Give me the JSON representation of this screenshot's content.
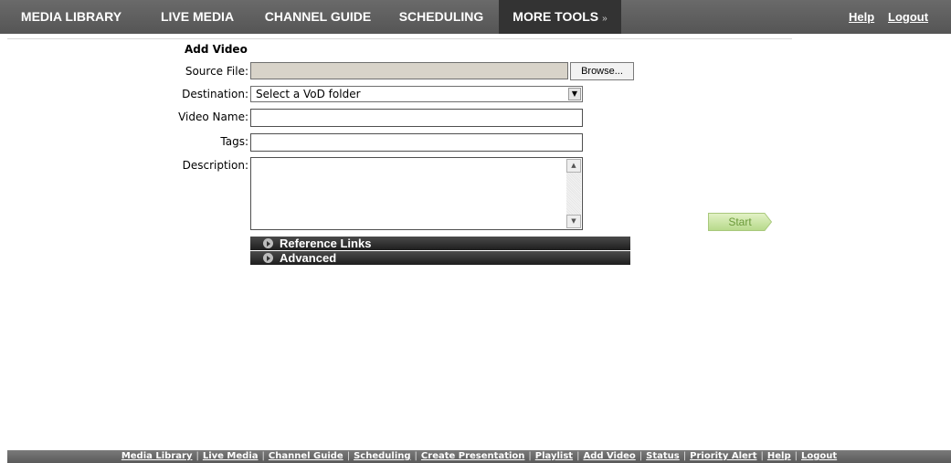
{
  "nav": {
    "tabs": [
      {
        "label": "MEDIA LIBRARY"
      },
      {
        "label": "LIVE MEDIA"
      },
      {
        "label": "CHANNEL GUIDE"
      },
      {
        "label": "SCHEDULING"
      },
      {
        "label": "MORE TOOLS",
        "chevron": "»"
      }
    ],
    "help": "Help",
    "logout": "Logout"
  },
  "form": {
    "heading": "Add Video",
    "source_label": "Source File:",
    "browse_label": "Browse...",
    "destination_label": "Destination:",
    "destination_value": "Select a VoD folder",
    "video_name_label": "Video Name:",
    "tags_label": "Tags:",
    "description_label": "Description:",
    "start_label": "Start",
    "reference_links": "Reference Links",
    "advanced": "Advanced"
  },
  "footer": {
    "links": [
      "Media Library",
      "Live Media",
      "Channel Guide",
      "Scheduling",
      "Create Presentation",
      "Playlist",
      "Add Video",
      "Status",
      "Priority Alert",
      "Help",
      "Logout"
    ],
    "separator": "|"
  },
  "colors": {
    "nav_bg": "#5f5f5f",
    "nav_active": "#333333",
    "start_green": "#c7e39a",
    "source_field_bg": "#d8d3c9"
  }
}
